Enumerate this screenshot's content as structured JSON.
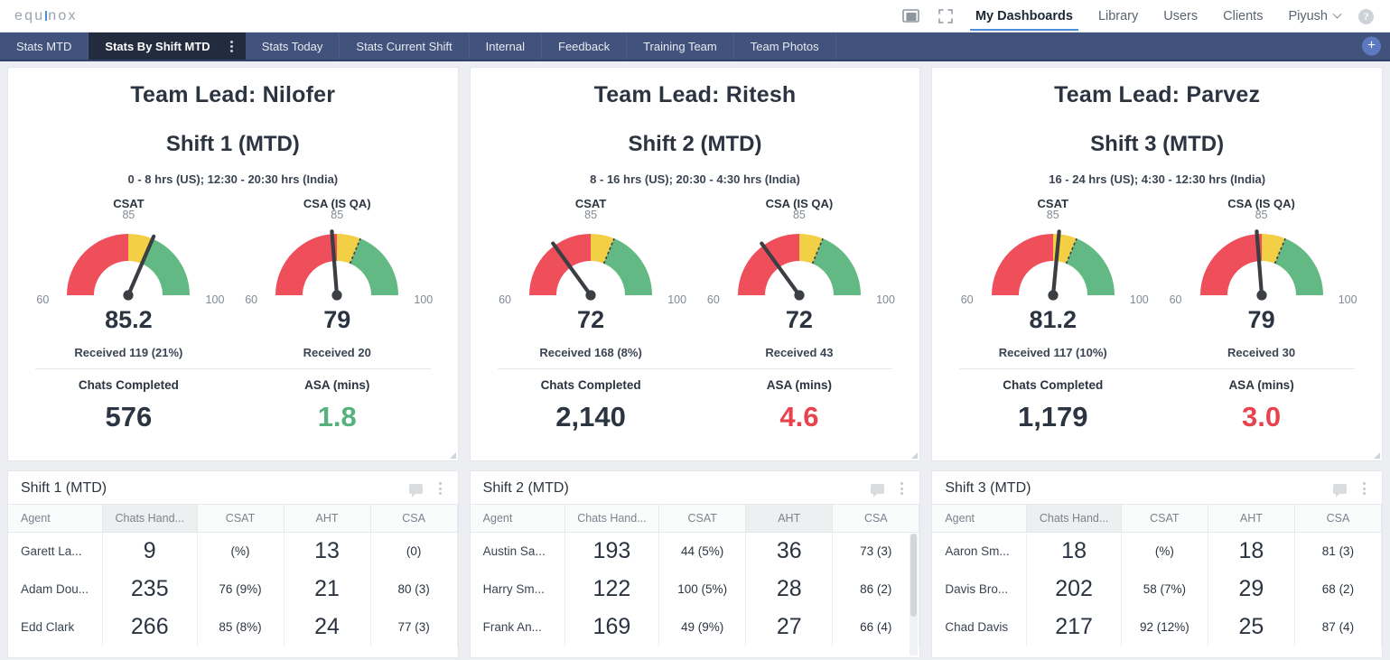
{
  "brand": {
    "logo_text": "equinox"
  },
  "topnav": {
    "icons": [
      {
        "name": "present-mode-icon",
        "glyph": "present"
      },
      {
        "name": "fullscreen-icon",
        "glyph": "expand"
      }
    ],
    "links": [
      {
        "label": "My Dashboards",
        "active": true
      },
      {
        "label": "Library",
        "active": false
      },
      {
        "label": "Users",
        "active": false
      },
      {
        "label": "Clients",
        "active": false
      }
    ],
    "user": "Piyush",
    "help_label": "?"
  },
  "tabs": [
    {
      "label": "Stats MTD",
      "active": false
    },
    {
      "label": "Stats By Shift MTD",
      "active": true
    },
    {
      "label": "Stats Today",
      "active": false
    },
    {
      "label": "Stats Current Shift",
      "active": false
    },
    {
      "label": "Internal",
      "active": false
    },
    {
      "label": "Feedback",
      "active": false
    },
    {
      "label": "Training Team",
      "active": false
    },
    {
      "label": "Team Photos",
      "active": false
    }
  ],
  "add_tab_label": "+",
  "colors": {
    "gauge_red": "#ee4f5a",
    "gauge_yellow": "#f2cf44",
    "gauge_green": "#62b983",
    "needle": "#3b3f44",
    "good": "#55b27c",
    "bad": "#e8424e",
    "tabbar": "#41537c",
    "tab_active": "#232b3e",
    "accent": "#4a90d9"
  },
  "gauge_axis": {
    "min": 60,
    "max": 100,
    "target": 85,
    "min_label": "60",
    "max_label": "100",
    "target_label": "85"
  },
  "chart_data": [
    {
      "type": "gauge",
      "title": "Shift 1 (MTD) CSAT",
      "value": 85.2,
      "min": 60,
      "max": 100,
      "bands": [
        {
          "from": 60,
          "to": 80,
          "color": "#ee4f5a"
        },
        {
          "from": 80,
          "to": 85,
          "color": "#f2cf44"
        },
        {
          "from": 85,
          "to": 100,
          "color": "#62b983"
        }
      ],
      "ticks": [
        60,
        85,
        100
      ]
    },
    {
      "type": "gauge",
      "title": "Shift 1 (MTD) CSA (IS QA)",
      "value": 79,
      "min": 60,
      "max": 100,
      "bands": [
        {
          "from": 60,
          "to": 80,
          "color": "#ee4f5a"
        },
        {
          "from": 80,
          "to": 85,
          "color": "#f2cf44"
        },
        {
          "from": 85,
          "to": 100,
          "color": "#62b983"
        }
      ],
      "ticks": [
        60,
        85,
        100
      ]
    },
    {
      "type": "gauge",
      "title": "Shift 2 (MTD) CSAT",
      "value": 72,
      "min": 60,
      "max": 100,
      "bands": [
        {
          "from": 60,
          "to": 80,
          "color": "#ee4f5a"
        },
        {
          "from": 80,
          "to": 85,
          "color": "#f2cf44"
        },
        {
          "from": 85,
          "to": 100,
          "color": "#62b983"
        }
      ],
      "ticks": [
        60,
        85,
        100
      ]
    },
    {
      "type": "gauge",
      "title": "Shift 2 (MTD) CSA (IS QA)",
      "value": 72,
      "min": 60,
      "max": 100,
      "bands": [
        {
          "from": 60,
          "to": 80,
          "color": "#ee4f5a"
        },
        {
          "from": 80,
          "to": 85,
          "color": "#f2cf44"
        },
        {
          "from": 85,
          "to": 100,
          "color": "#62b983"
        }
      ],
      "ticks": [
        60,
        85,
        100
      ]
    },
    {
      "type": "gauge",
      "title": "Shift 3 (MTD) CSAT",
      "value": 81.2,
      "min": 60,
      "max": 100,
      "bands": [
        {
          "from": 60,
          "to": 80,
          "color": "#ee4f5a"
        },
        {
          "from": 80,
          "to": 85,
          "color": "#f2cf44"
        },
        {
          "from": 85,
          "to": 100,
          "color": "#62b983"
        }
      ],
      "ticks": [
        60,
        85,
        100
      ]
    },
    {
      "type": "gauge",
      "title": "Shift 3 (MTD) CSA (IS QA)",
      "value": 79,
      "min": 60,
      "max": 100,
      "bands": [
        {
          "from": 60,
          "to": 80,
          "color": "#ee4f5a"
        },
        {
          "from": 80,
          "to": 85,
          "color": "#f2cf44"
        },
        {
          "from": 85,
          "to": 100,
          "color": "#62b983"
        }
      ],
      "ticks": [
        60,
        85,
        100
      ]
    }
  ],
  "summaries": [
    {
      "lead": "Team Lead: Nilofer",
      "shift": "Shift 1 (MTD)",
      "hours": "0 - 8 hrs (US); 12:30 - 20:30 hrs (India)",
      "gauges": [
        {
          "label": "CSAT",
          "value": 85.2,
          "value_text": "85.2",
          "received": "Received 119 (21%)"
        },
        {
          "label": "CSA (IS QA)",
          "value": 79,
          "value_text": "79",
          "received": "Received 20"
        }
      ],
      "kpis": [
        {
          "label": "Chats Completed",
          "value": "576",
          "tone": "neutral"
        },
        {
          "label": "ASA (mins)",
          "value": "1.8",
          "tone": "good"
        }
      ]
    },
    {
      "lead": "Team Lead: Ritesh",
      "shift": "Shift 2 (MTD)",
      "hours": "8 - 16 hrs (US); 20:30 - 4:30 hrs (India)",
      "gauges": [
        {
          "label": "CSAT",
          "value": 72,
          "value_text": "72",
          "received": "Received 168 (8%)"
        },
        {
          "label": "CSA (IS QA)",
          "value": 72,
          "value_text": "72",
          "received": "Received 43"
        }
      ],
      "kpis": [
        {
          "label": "Chats Completed",
          "value": "2,140",
          "tone": "neutral"
        },
        {
          "label": "ASA (mins)",
          "value": "4.6",
          "tone": "bad"
        }
      ]
    },
    {
      "lead": "Team Lead: Parvez",
      "shift": "Shift 3 (MTD)",
      "hours": "16 - 24 hrs (US); 4:30 - 12:30 hrs (India)",
      "gauges": [
        {
          "label": "CSAT",
          "value": 81.2,
          "value_text": "81.2",
          "received": "Received 117 (10%)"
        },
        {
          "label": "CSA (IS QA)",
          "value": 79,
          "value_text": "79",
          "received": "Received 30"
        }
      ],
      "kpis": [
        {
          "label": "Chats Completed",
          "value": "1,179",
          "tone": "neutral"
        },
        {
          "label": "ASA (mins)",
          "value": "3.0",
          "tone": "bad"
        }
      ]
    }
  ],
  "tables": [
    {
      "title": "Shift 1 (MTD)",
      "columns": [
        "Agent",
        "Chats Hand...",
        "CSAT",
        "AHT",
        "CSA"
      ],
      "sorted_column": "Chats Hand...",
      "scrollbar": false,
      "rows": [
        {
          "agent": "Garett La...",
          "chats": "9",
          "csat": "(%)",
          "csat_tone": "bad",
          "aht": "13",
          "csa": "(0)",
          "csa_tone": "bad"
        },
        {
          "agent": "Adam Dou...",
          "chats": "235",
          "csat": "76 (9%)",
          "csat_tone": "neutral",
          "aht": "21",
          "csa": "80 (3)",
          "csa_tone": "good"
        },
        {
          "agent": "Edd Clark",
          "chats": "266",
          "csat": "85 (8%)",
          "csat_tone": "good",
          "aht": "24",
          "csa": "77 (3)",
          "csa_tone": "neutral"
        }
      ]
    },
    {
      "title": "Shift 2 (MTD)",
      "columns": [
        "Agent",
        "Chats Hand...",
        "CSAT",
        "AHT",
        "CSA"
      ],
      "sorted_column": "AHT",
      "scrollbar": true,
      "rows": [
        {
          "agent": "Austin Sa...",
          "chats": "193",
          "csat": "44 (5%)",
          "csat_tone": "bad",
          "aht": "36",
          "csa": "73 (3)",
          "csa_tone": "neutral"
        },
        {
          "agent": "Harry Sm...",
          "chats": "122",
          "csat": "100 (5%)",
          "csat_tone": "good",
          "aht": "28",
          "csa": "86 (2)",
          "csa_tone": "good"
        },
        {
          "agent": "Frank An...",
          "chats": "169",
          "csat": "49 (9%)",
          "csat_tone": "bad",
          "aht": "27",
          "csa": "66 (4)",
          "csa_tone": "neutral"
        }
      ]
    },
    {
      "title": "Shift 3 (MTD)",
      "columns": [
        "Agent",
        "Chats Hand...",
        "CSAT",
        "AHT",
        "CSA"
      ],
      "sorted_column": "Chats Hand...",
      "scrollbar": false,
      "rows": [
        {
          "agent": "Aaron Sm...",
          "chats": "18",
          "csat": "(%)",
          "csat_tone": "bad",
          "aht": "18",
          "csa": "81 (3)",
          "csa_tone": "good"
        },
        {
          "agent": "Davis Bro...",
          "chats": "202",
          "csat": "58 (7%)",
          "csat_tone": "bad",
          "aht": "29",
          "csa": "68 (2)",
          "csa_tone": "neutral"
        },
        {
          "agent": "Chad Davis",
          "chats": "217",
          "csat": "92 (12%)",
          "csat_tone": "good",
          "aht": "25",
          "csa": "87 (4)",
          "csa_tone": "good"
        }
      ]
    }
  ]
}
